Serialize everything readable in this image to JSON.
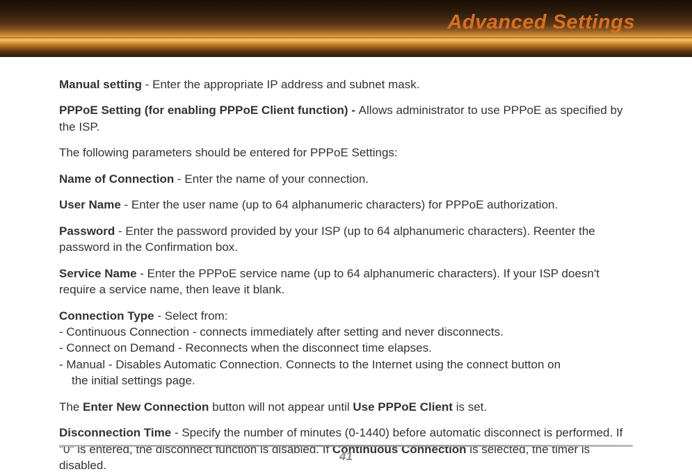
{
  "header": {
    "title": "Advanced Settings"
  },
  "content": {
    "p1_b": "Manual setting",
    "p1_t": " - Enter the appropriate IP address and subnet mask.",
    "p2_b": "PPPoE Setting (for enabling PPPoE Client function) - ",
    "p2_t": "Allows administrator to use PPPoE as specified by the ISP.",
    "p3": "The following parameters should be entered for PPPoE Settings:",
    "p4_b": "Name of Connection",
    "p4_t": " - Enter the name of your connection.",
    "p5_b": "User Name",
    "p5_t": " - Enter the user name (up to 64 alphanumeric characters) for PPPoE authorization.",
    "p6_b": "Password",
    "p6_t": " - Enter the password provided by your ISP (up to 64 alphanumeric characters).  Reenter the password in the Confirmation box.",
    "p7_b": "Service Name",
    "p7_t": " - Enter the PPPoE service name (up to 64 alphanumeric characters).  If your ISP doesn't require a service name, then leave it blank.",
    "p8_b": "Connection Type",
    "p8_t": " - Select from:",
    "p8_l1": "- Continuous Connection - connects immediately after setting and never disconnects.",
    "p8_l2": "- Connect on Demand - Reconnects when the disconnect time elapses.",
    "p8_l3a": "- Manual - Disables Automatic Connection.  Connects to the Internet using  the connect button on",
    "p8_l3b": "the initial settings page.",
    "p9_a": "The ",
    "p9_b1": "Enter New Connection",
    "p9_m": " button will not appear until ",
    "p9_b2": "Use PPPoE Client",
    "p9_e": " is set.",
    "p10_b": "Disconnection Time",
    "p10_a": " - Specify the number of minutes (0-1440) before automatic disconnect is performed.  If \"0\" is entered, the disconnect function is disabled.  If ",
    "p10_b2": "Continuous Connection",
    "p10_e": " is selected, the timer is disabled."
  },
  "footer": {
    "page": "41"
  }
}
